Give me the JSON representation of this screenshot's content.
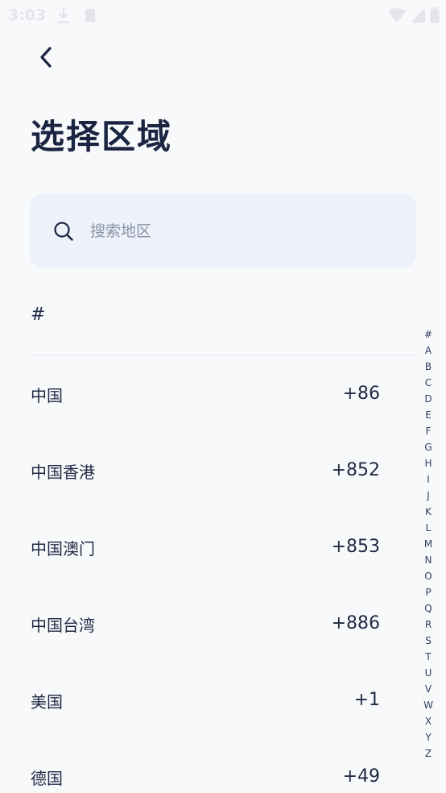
{
  "status_bar": {
    "time": "3:03"
  },
  "header": {
    "title": "选择区域"
  },
  "search": {
    "placeholder": "搜索地区"
  },
  "section": {
    "label": "#"
  },
  "regions": [
    {
      "name": "中国",
      "code": "+86"
    },
    {
      "name": "中国香港",
      "code": "+852"
    },
    {
      "name": "中国澳门",
      "code": "+853"
    },
    {
      "name": "中国台湾",
      "code": "+886"
    },
    {
      "name": "美国",
      "code": "+1"
    },
    {
      "name": "德国",
      "code": "+49"
    }
  ],
  "alphabet": [
    "#",
    "A",
    "B",
    "C",
    "D",
    "E",
    "F",
    "G",
    "H",
    "I",
    "J",
    "K",
    "L",
    "M",
    "N",
    "O",
    "P",
    "Q",
    "R",
    "S",
    "T",
    "U",
    "V",
    "W",
    "X",
    "Y",
    "Z"
  ],
  "colors": {
    "background": "#f8f9fb",
    "text": "#1f2a44",
    "search_bg": "#edf2fa",
    "placeholder": "#8a93a6"
  },
  "icons": {
    "back": "chevron-left-icon",
    "search": "search-icon"
  }
}
